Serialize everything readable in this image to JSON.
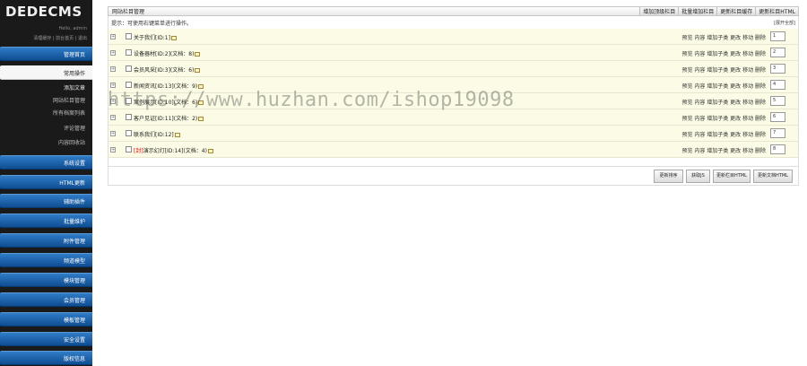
{
  "sidebar": {
    "logo": "DEDECMS",
    "hello": "Hello, admin",
    "userlinks": "清理缓存 | 前台首页 | 退出",
    "buttons": [
      {
        "label": "管理首页"
      },
      {
        "label": "常用操作",
        "active": true
      }
    ],
    "subitems": [
      "添加文章",
      "网站栏目管理",
      "所有档案列表",
      "评论管理",
      "内容回收站"
    ],
    "menu": [
      "系统设置",
      "HTML更新",
      "辅助插件",
      "批量维护",
      "附件管理",
      "频道模型",
      "模块管理",
      "会员管理",
      "模板管理",
      "安全设置",
      "版权信息"
    ]
  },
  "main": {
    "title": "网站栏目管理",
    "toolbar": [
      "增加顶级栏目",
      "批量增加栏目",
      "更新栏目缓存",
      "更新栏目HTML"
    ],
    "tip": "提示：可使用右键菜单进行操作。",
    "expand_all": "[展开全部]",
    "ops_text": "预览 内容 增加子类 更改 移动 删除",
    "rows": [
      {
        "name": "关于我们[ID:1]",
        "order": "1"
      },
      {
        "name": "设备器材[ID:2](文档：8)",
        "order": "2"
      },
      {
        "name": "会员风采[ID:3](文档：6)",
        "order": "3"
      },
      {
        "name": "新闻资讯[ID:13](文档：9)",
        "order": "4"
      },
      {
        "name": "案例展示[ID:10](文档：6)",
        "order": "5"
      },
      {
        "name": "客户见证[ID:11](文档：2)",
        "order": "6"
      },
      {
        "name": "联系我们[ID:12]",
        "order": "7"
      },
      {
        "prefix": "[封]",
        "name": "演示幻灯[ID:14](文档：4)",
        "order": "8"
      }
    ],
    "footer_buttons": [
      "更新排序",
      "获取JS",
      "更新栏目HTML",
      "更新文档HTML"
    ]
  },
  "watermark": "https://www.huzhan.com/ishop19098"
}
